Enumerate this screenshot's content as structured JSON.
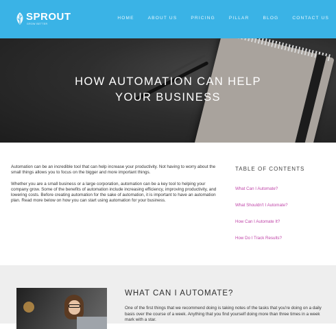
{
  "brand": {
    "name": "SPROUT",
    "tagline": "GROW BETTER"
  },
  "nav": {
    "items": [
      "HOME",
      "ABOUT US",
      "PRICING",
      "PILLAR",
      "BLOG",
      "CONTACT US"
    ]
  },
  "hero": {
    "title_line1": "HOW AUTOMATION CAN HELP",
    "title_line2": "YOUR BUSINESS"
  },
  "intro": {
    "paragraph1": "Automation can be an incredible tool that can help increase your productivity. Not having to worry about the small things allows you to focus on the bigger and more important things.",
    "paragraph2": "Whether you are a small business or a large corporation, automation can be a key tool to helping your company grow. Some of the benefits of automation include increasing efficiency, improving productivity, and lowering costs. Before creating automation for the sake of automation, it is important to have an automation plan. Read more below on how you can start using automation for your business."
  },
  "toc": {
    "title": "TABLE OF CONTENTS",
    "links": [
      "What Can I Automate?",
      "What Shouldn't I Automate?",
      "How Can I Automate It?",
      "How Do I Track Results?"
    ]
  },
  "section2": {
    "title": "WHAT CAN I AUTOMATE?",
    "body": "One of the first things that we recommend doing is taking notes of the tasks that you're doing on a daily basis over the course of a week. Anything that you find yourself doing more than three times in a week mark with a star."
  },
  "colors": {
    "header_bg": "#3ab3e6",
    "link": "#c046a9",
    "section_bg": "#eeeeee"
  }
}
